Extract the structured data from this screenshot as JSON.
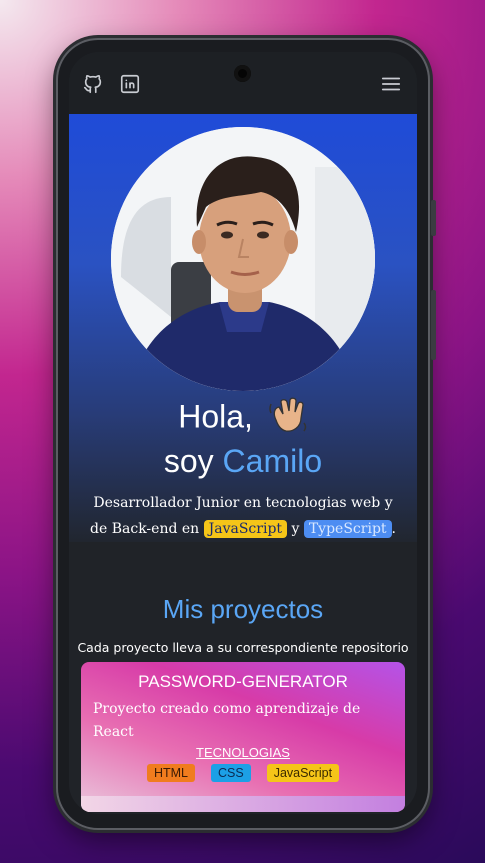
{
  "nav": {
    "github_icon": "github-icon",
    "linkedin_icon": "linkedin-icon",
    "menu_icon": "hamburger-menu-icon"
  },
  "hero": {
    "greeting": "Hola,",
    "wave_emoji": "👋",
    "intro": "soy ",
    "name": "Camilo",
    "desc_part1": "Desarrollador Junior en tecnologias web y de Back-end en ",
    "tag_js": "JavaScript",
    "desc_join": " y ",
    "tag_ts": "TypeScript",
    "desc_end": "."
  },
  "projects": {
    "title": "Mis proyectos",
    "subtitle": "Cada proyecto lleva a su correspondiente repositorio",
    "items": [
      {
        "name": "PASSWORD-GENERATOR",
        "description": "Proyecto creado como aprendizaje de React",
        "tech_label": "TECNOLOGIAS",
        "tech": [
          "HTML",
          "CSS",
          "JavaScript"
        ]
      }
    ]
  },
  "colors": {
    "accent": "#5aa6f5",
    "hero_top": "#1f4bd8",
    "js_tag": "#f5c518",
    "ts_tag": "#4d8df2",
    "html_chip": "#f07c1e",
    "css_chip": "#1ca0e6"
  }
}
